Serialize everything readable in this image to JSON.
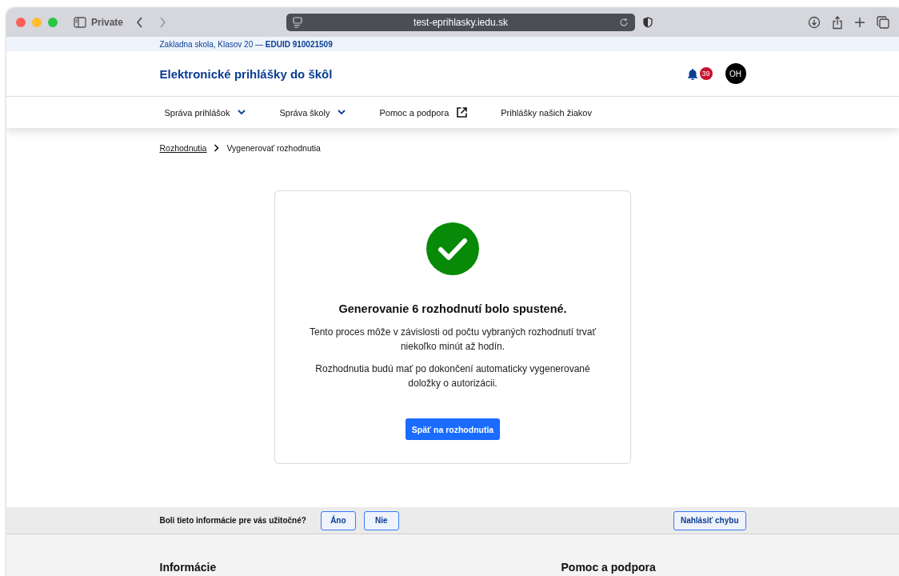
{
  "browser": {
    "private_label": "Private",
    "url": "test-eprihlasky.iedu.sk"
  },
  "school_strip": {
    "text": "Zakladna skola, Klasov 20 — **EDUID 910021509**"
  },
  "header": {
    "title": "Elektronické prihlášky do škôl",
    "notification_count": "39",
    "avatar_initials": "OH"
  },
  "nav": [
    {
      "label": "Správa prihlášok",
      "kind": "dropdown"
    },
    {
      "label": "Správa školy",
      "kind": "dropdown"
    },
    {
      "label": "Pomoc a podpora",
      "kind": "external"
    },
    {
      "label": "Prihlášky našich žiakov",
      "kind": "link"
    }
  ],
  "breadcrumb": [
    {
      "label": "Rozhodnutia",
      "kind": "link"
    },
    {
      "label": "Vygenerovať rozhodnutia",
      "kind": "current"
    }
  ],
  "result": {
    "kind": "success",
    "heading": "Generovanie 6 rozhodnutí bolo spustené.",
    "paragraphs": [
      "Tento proces môže v závislosti od počtu vybraných rozhodnutí trvať niekoľko minút až hodín.",
      "Rozhodnutia budú mať po dokončení automaticky vygenerované doložky o autorizácii."
    ],
    "button": "Späť na rozhodnutia"
  },
  "feedback": {
    "question": "Boli tieto informácie pre vás užitočné?",
    "answers": [
      "Áno",
      "Nie"
    ],
    "report_button": "Nahlásiť chybu"
  },
  "footer": {
    "headings": [
      "Informácie",
      "Pomoc a podpora"
    ]
  }
}
